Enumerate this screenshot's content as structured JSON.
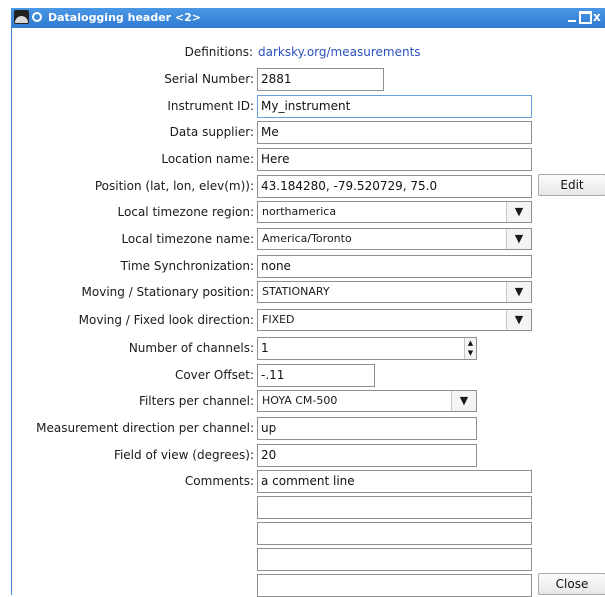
{
  "window": {
    "title": "Datalogging header <2>",
    "close_glyph": "x"
  },
  "definitions": {
    "label": "Definitions:",
    "link": "darksky.org/measurements"
  },
  "fields": {
    "serial_number": {
      "label": "Serial Number:",
      "value": "2881"
    },
    "instrument_id": {
      "label": "Instrument ID:",
      "value": "My_instrument"
    },
    "data_supplier": {
      "label": "Data supplier:",
      "value": "Me"
    },
    "location_name": {
      "label": "Location name:",
      "value": "Here"
    },
    "position": {
      "label": "Position (lat, lon, elev(m)):",
      "value": "43.184280, -79.520729, 75.0",
      "edit_label": "Edit"
    },
    "timezone_region": {
      "label": "Local timezone region:",
      "value": "northamerica"
    },
    "timezone_name": {
      "label": "Local timezone name:",
      "value": "America/Toronto"
    },
    "time_sync": {
      "label": "Time Synchronization:",
      "value": "none"
    },
    "moving_position": {
      "label": "Moving / Stationary position:",
      "value": "STATIONARY"
    },
    "look_direction": {
      "label": "Moving / Fixed look direction:",
      "value": "FIXED"
    },
    "num_channels": {
      "label": "Number of channels:",
      "value": "1"
    },
    "cover_offset": {
      "label": "Cover Offset:",
      "value": "-.11"
    },
    "filters": {
      "label": "Filters per channel:",
      "value": "HOYA CM-500"
    },
    "measurement_direction": {
      "label": "Measurement direction per channel:",
      "value": "up"
    },
    "field_of_view": {
      "label": "Field of view (degrees):",
      "value": "20"
    },
    "comments": {
      "label": "Comments:",
      "lines": [
        "a comment line",
        "",
        "",
        "",
        ""
      ]
    }
  },
  "buttons": {
    "close": "Close"
  },
  "glyphs": {
    "dropdown": "▼",
    "spin_up": "▲",
    "spin_down": "▼"
  },
  "colors": {
    "titlebar": "#3a88dc",
    "link": "#2a52be",
    "focus_border": "#6aa0e0"
  }
}
